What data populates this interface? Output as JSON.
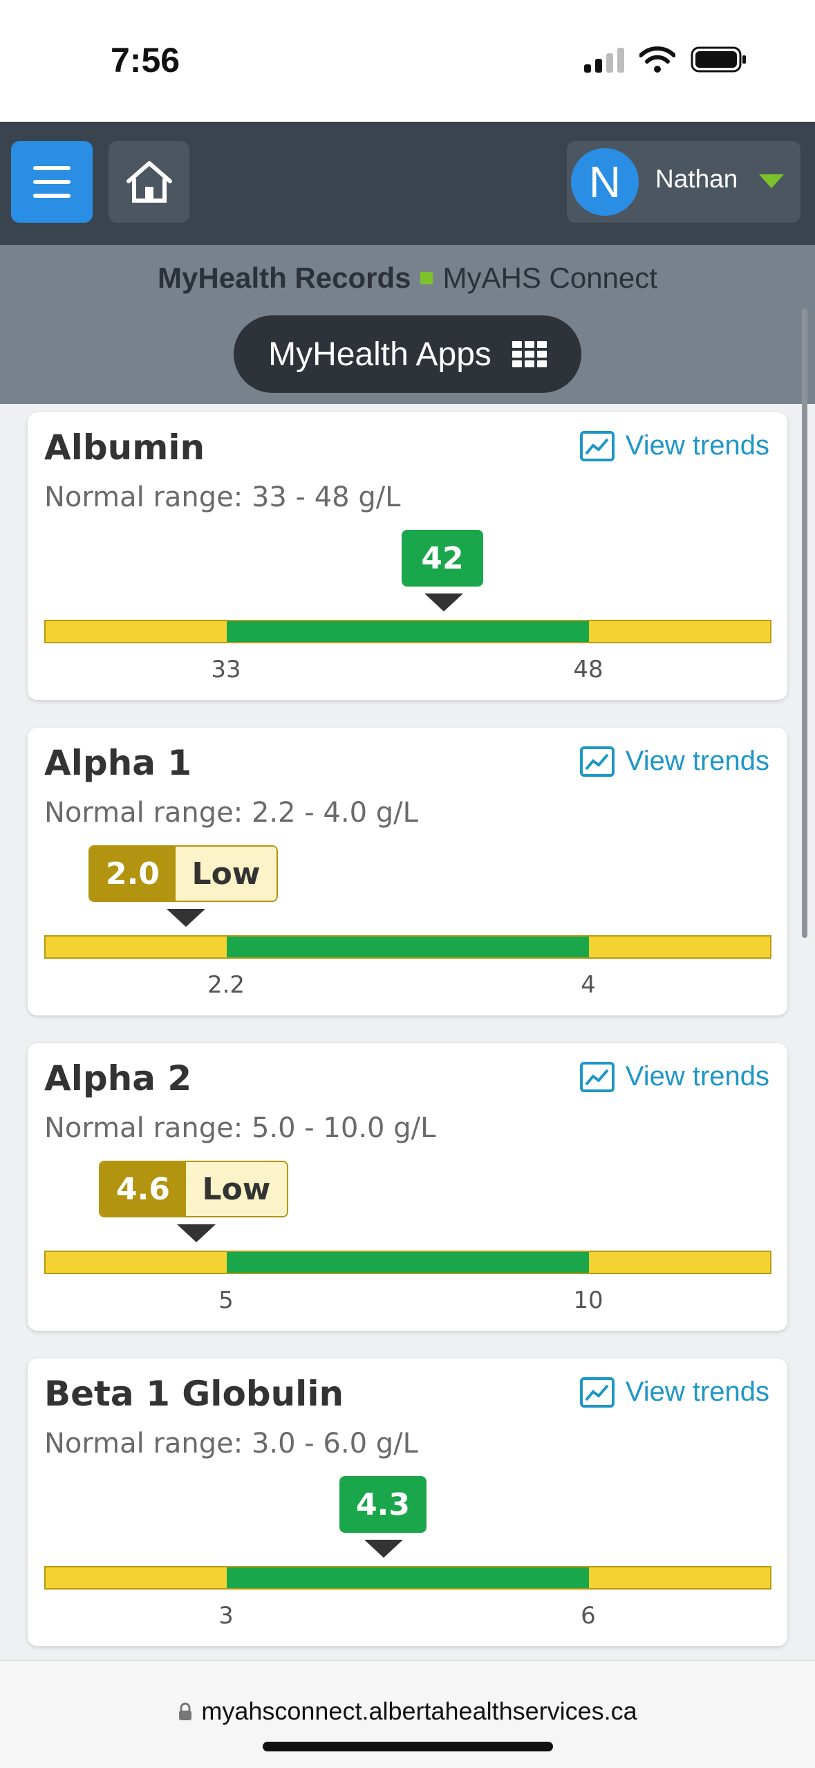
{
  "status_bar": {
    "time": "7:56"
  },
  "header": {
    "user_initial": "N",
    "user_name": "Nathan"
  },
  "subheader": {
    "brand_primary": "MyHealth Records",
    "brand_secondary": "MyAHS Connect",
    "apps_label": "MyHealth Apps"
  },
  "results": [
    {
      "title": "Albumin",
      "trends_label": "View trends",
      "range_text": "Normal range: 33 - 48 g/L",
      "value": "42",
      "flag": "",
      "low": "33",
      "high": "48"
    },
    {
      "title": "Alpha 1",
      "trends_label": "View trends",
      "range_text": "Normal range: 2.2 - 4.0 g/L",
      "value": "2.0",
      "flag": "Low",
      "low": "2.2",
      "high": "4"
    },
    {
      "title": "Alpha 2",
      "trends_label": "View trends",
      "range_text": "Normal range: 5.0 - 10.0 g/L",
      "value": "4.6",
      "flag": "Low",
      "low": "5",
      "high": "10"
    },
    {
      "title": "Beta 1 Globulin",
      "trends_label": "View trends",
      "range_text": "Normal range: 3.0 - 6.0 g/L",
      "value": "4.3",
      "flag": "",
      "low": "3",
      "high": "6"
    }
  ],
  "browser": {
    "url": "myahsconnect.albertahealthservices.ca"
  },
  "colors": {
    "header_bg": "#3a444e",
    "accent_blue": "#2a8ee4",
    "normal_green": "#1aa64a",
    "out_of_range_yellow": "#f4d232",
    "low_flag": "#b39410",
    "trend_link": "#1e96c8"
  }
}
